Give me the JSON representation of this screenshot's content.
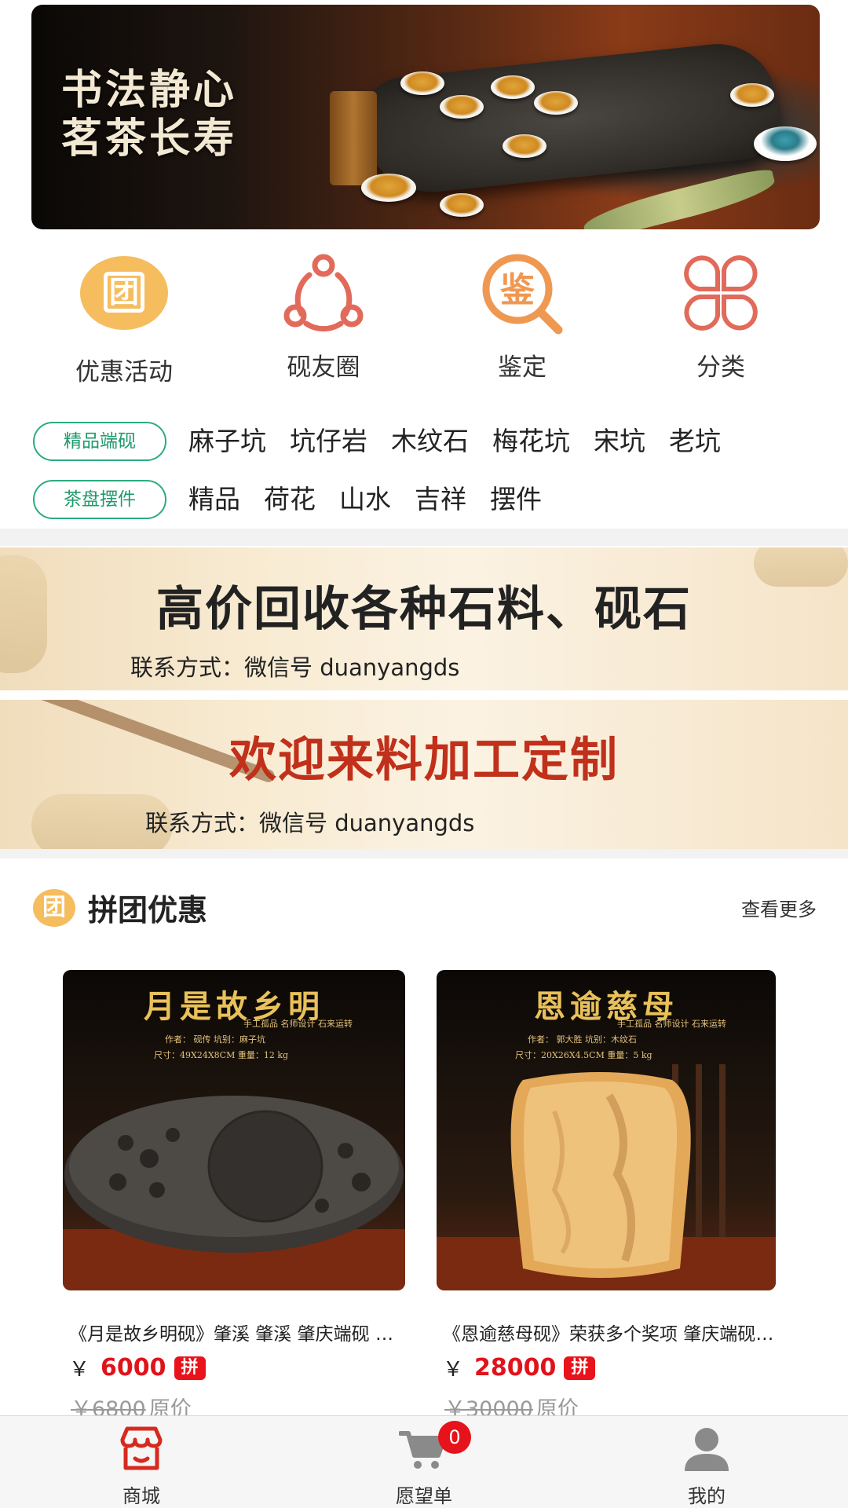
{
  "hero": {
    "line1": "书法静心",
    "line2": "茗茶长寿"
  },
  "quick_nav": [
    {
      "label": "优惠活动",
      "icon": "group-buy-icon"
    },
    {
      "label": "砚友圈",
      "icon": "share-circle-icon"
    },
    {
      "label": "鉴定",
      "icon": "appraisal-magnifier-icon"
    },
    {
      "label": "分类",
      "icon": "category-grid-icon"
    }
  ],
  "tag_rows": [
    {
      "pill": "精品端砚",
      "tags": [
        "麻子坑",
        "坑仔岩",
        "木纹石",
        "梅花坑",
        "宋坑",
        "老坑"
      ]
    },
    {
      "pill": "茶盘摆件",
      "tags": [
        "精品",
        "荷花",
        "山水",
        "吉祥",
        "摆件"
      ]
    }
  ],
  "promos": [
    {
      "title": "高价回收各种石料、砚石",
      "contact": "联系方式：微信号 duanyangds",
      "title_color": "#111111"
    },
    {
      "title": "欢迎来料加工定制",
      "contact": "联系方式：微信号 duanyangds",
      "title_color": "#c0301a"
    }
  ],
  "section": {
    "badge": "团",
    "title": "拼团优惠",
    "more": "查看更多"
  },
  "products": [
    {
      "image_title": "月是故乡明",
      "image_line1": "手工孤品  名师设计  石来运转",
      "image_line2": "作者：   砚传    坑别：麻子坑",
      "image_line3": "尺寸：49X24X8CM    重量：12    kg",
      "name": "《月是故乡明砚》肇溪 肇溪 肇庆端砚 砚台 雕刻",
      "currency": "￥",
      "price": "6000",
      "pin": "拼",
      "orig_price": "￥6800",
      "orig_label": "原价"
    },
    {
      "image_title": "恩逾慈母",
      "image_line1": "手工孤品  名师设计  石来运转",
      "image_line2": "作者：  郭大胜   坑别：木纹石",
      "image_line3": "尺寸：20X26X4.5CM   重量：5    kg",
      "name": "《恩逾慈母砚》荣获多个奖项 肇庆端砚 木纹石",
      "currency": "￥",
      "price": "28000",
      "pin": "拼",
      "orig_price": "￥30000",
      "orig_label": "原价"
    }
  ],
  "tabbar": [
    {
      "label": "商城",
      "icon": "store-icon",
      "active": true,
      "color": "#d62a1f"
    },
    {
      "label": "愿望单",
      "icon": "cart-icon",
      "badge": "0",
      "color": "#8a8a8a"
    },
    {
      "label": "我的",
      "icon": "user-icon",
      "color": "#8a8a8a"
    }
  ],
  "colors": {
    "accent_green": "#2bac7d",
    "price_red": "#e0131b",
    "orange": "#f5bd5e",
    "coral": "#e26a5a"
  }
}
